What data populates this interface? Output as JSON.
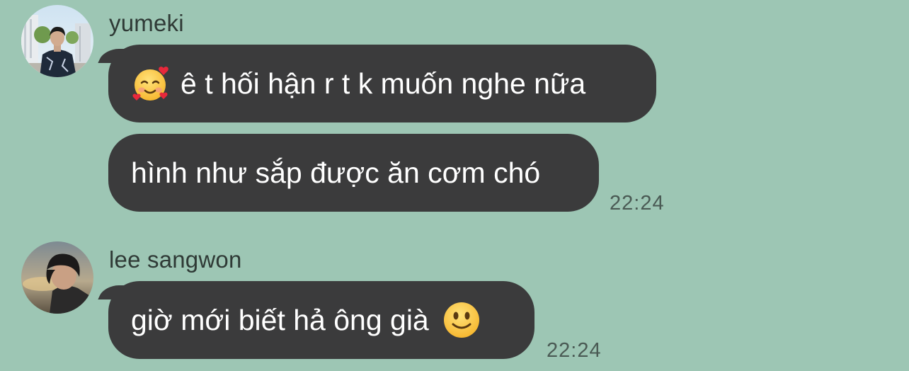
{
  "messages": [
    {
      "sender": "yumeki",
      "bubbles": [
        {
          "lead_emoji": "smiling-face-with-hearts-icon",
          "text": "ê t hối hận r t k muốn nghe nữa"
        },
        {
          "text": "hình như sắp được ăn cơm chó"
        }
      ],
      "time": "22:24"
    },
    {
      "sender": "lee sangwon",
      "bubbles": [
        {
          "text": "giờ mới biết hả ông già",
          "trail_emoji": "slightly-smiling-face-icon"
        }
      ],
      "time": "22:24"
    }
  ],
  "colors": {
    "background": "#9dc6b4",
    "bubble": "#3b3b3c",
    "bubble_text": "#ffffff",
    "name_text": "#2f3a36",
    "time_text": "#4a5a54"
  }
}
